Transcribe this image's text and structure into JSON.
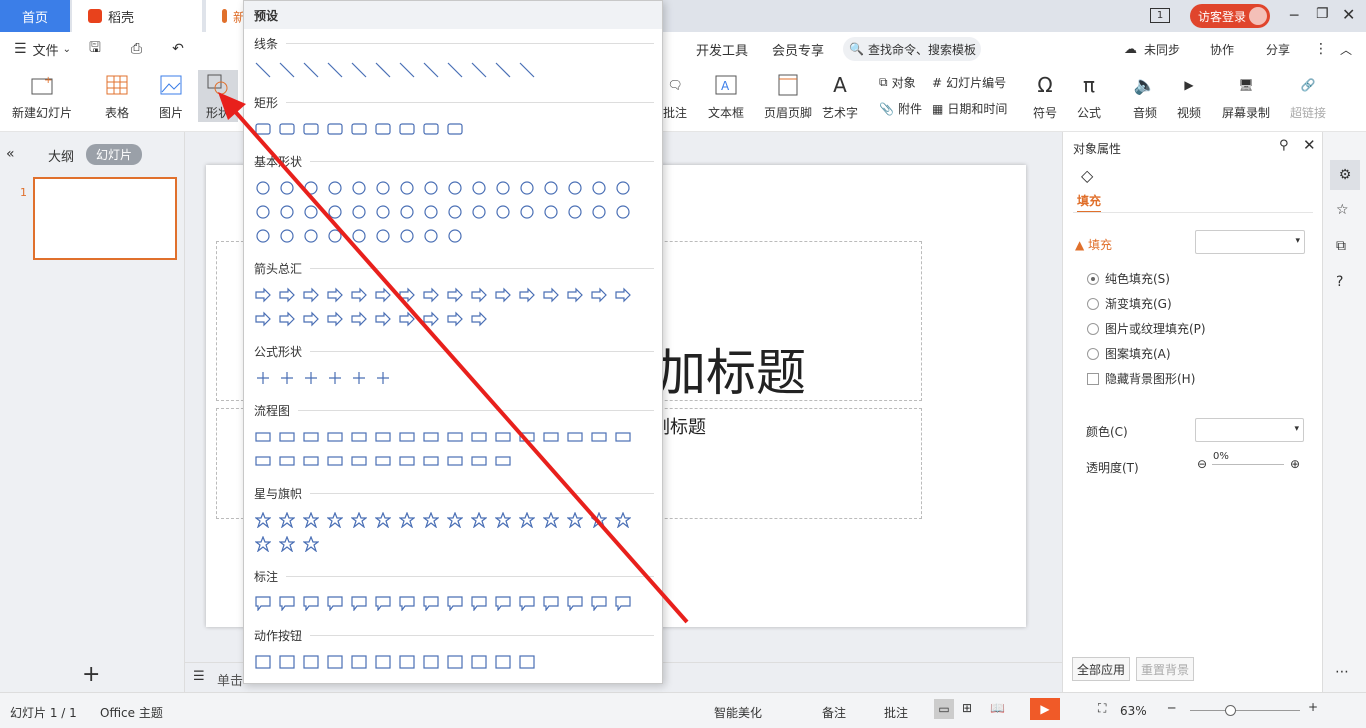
{
  "tabs": {
    "home": "首页",
    "daoke": "稻壳",
    "doc": "新",
    "visitor": "访客登录"
  },
  "menu": {
    "file": "文件",
    "dev": "开发工具",
    "member": "会员专享",
    "search": "查找命令、搜索模板",
    "unsync": "未同步",
    "collab": "协作",
    "share": "分享"
  },
  "ribbon": {
    "new_slide": "新建幻灯片",
    "table": "表格",
    "picture": "图片",
    "shape": "形状",
    "comment": "批注",
    "textbox": "文本框",
    "header_footer": "页眉页脚",
    "wordart": "艺术字",
    "object": "对象",
    "slide_number": "幻灯片编号",
    "attachment": "附件",
    "datetime": "日期和时间",
    "symbol": "符号",
    "formula": "公式",
    "audio": "音频",
    "video": "视频",
    "screen_record": "屏幕录制",
    "hyperlink": "超链接"
  },
  "left": {
    "outline": "大纲",
    "slides": "幻灯片",
    "slide_num": "1"
  },
  "slide": {
    "title": "加标题",
    "subtitle": "副标题"
  },
  "notes": {
    "placeholder": "单击"
  },
  "dropdown": {
    "header": "预设",
    "sections": [
      "线条",
      "矩形",
      "基本形状",
      "箭头总汇",
      "公式形状",
      "流程图",
      "星与旗帜",
      "标注",
      "动作按钮"
    ]
  },
  "panel": {
    "title": "对象属性",
    "tab": "填充",
    "fill_label": "填充",
    "options": [
      "纯色填充(S)",
      "渐变填充(G)",
      "图片或纹理填充(P)",
      "图案填充(A)"
    ],
    "hide_bg": "隐藏背景图形(H)",
    "color": "颜色(C)",
    "transparency": "透明度(T)",
    "trans_value": "0%",
    "apply_all": "全部应用",
    "reset_bg": "重置背景"
  },
  "status": {
    "slide_count": "幻灯片 1 / 1",
    "theme": "Office 主题",
    "beautify": "智能美化",
    "notes": "备注",
    "comment": "批注",
    "zoom": "63%"
  },
  "colors": {
    "accent": "#3b7ee8",
    "arrow": "#e8201c",
    "orange": "#e0702c"
  }
}
